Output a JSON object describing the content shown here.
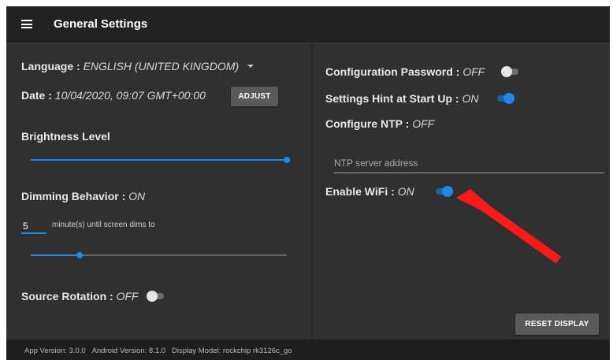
{
  "header": {
    "title": "General Settings",
    "menu_icon": "hamburger-menu-icon"
  },
  "left": {
    "language": {
      "label": "Language : ",
      "value": "ENGLISH (UNITED KINGDOM)"
    },
    "date": {
      "label": "Date : ",
      "value": "10/04/2020, 09:07 GMT+00:00",
      "adjust_label": "ADJUST"
    },
    "brightness": {
      "label": "Brightness Level",
      "level": 1.0
    },
    "dimming": {
      "label": "Dimming Behavior : ",
      "value": "ON",
      "minutes": "5",
      "minutes_text": "minute(s) until screen dims to",
      "dim_level": 0.19
    },
    "source_rotation": {
      "label": "Source Rotation : ",
      "value": "OFF",
      "toggle_on": false
    }
  },
  "right": {
    "config_password": {
      "label": "Configuration Password : ",
      "value": "OFF",
      "toggle_on": false
    },
    "settings_hint": {
      "label": "Settings Hint at Start Up : ",
      "value": "ON",
      "toggle_on": true
    },
    "configure_ntp": {
      "label": "Configure NTP : ",
      "value": "OFF"
    },
    "ntp_input": {
      "placeholder": "NTP server address",
      "value": ""
    },
    "enable_wifi": {
      "label": "Enable WiFi : ",
      "value": "ON",
      "toggle_on": true
    },
    "reset_label": "RESET DISPLAY"
  },
  "annotation": {
    "arrow_color": "#ff1a1a"
  },
  "colors": {
    "accent": "#1e88e5",
    "panel": "#303030",
    "background": "#2b2b2b",
    "footer": "#1e1e1e"
  },
  "footer": {
    "app_version": "App Version: 3.0.0",
    "android_version": "Android Version: 8.1.0",
    "display_model": "Display Model: rockchip rk3126c_go"
  }
}
